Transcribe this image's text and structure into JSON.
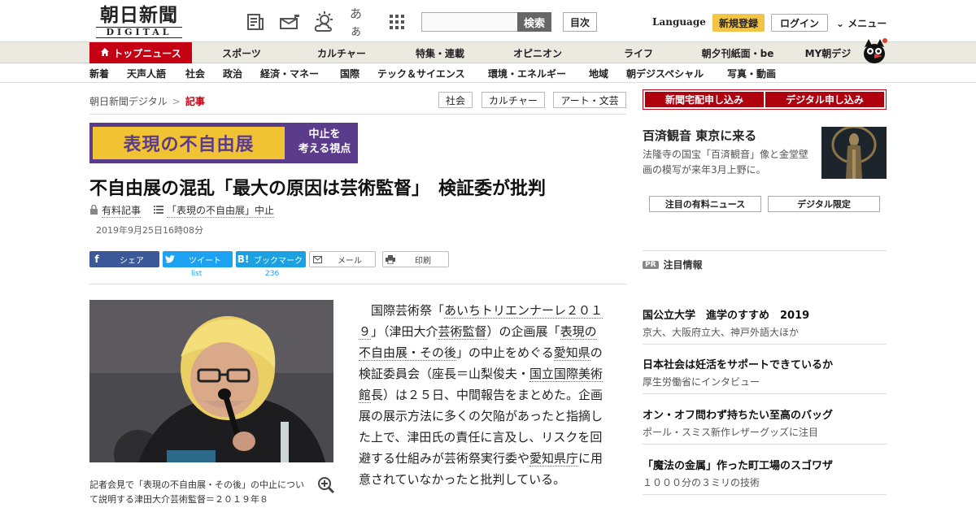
{
  "header": {
    "logo_main": "朝日新聞",
    "logo_sub": "DIGITAL",
    "search_button": "検索",
    "search_placeholder": "",
    "toc_button": "目次",
    "language_label": "Language",
    "register_button": "新規登録",
    "login_button": "ログイン",
    "menu_label": "メニュー",
    "font_size_icon_label": "あぁ"
  },
  "nav_primary": [
    {
      "label": "トップニュース",
      "active": true
    },
    {
      "label": "スポーツ"
    },
    {
      "label": "カルチャー"
    },
    {
      "label": "特集・連載"
    },
    {
      "label": "オピニオン"
    },
    {
      "label": "ライフ"
    },
    {
      "label": "朝夕刊紙面・be"
    },
    {
      "label": "MY朝デジ"
    }
  ],
  "nav_secondary": [
    {
      "label": "新着"
    },
    {
      "label": "天声人語"
    },
    {
      "label": "社会"
    },
    {
      "label": "政治"
    },
    {
      "label": "経済・マネー"
    },
    {
      "label": "国際"
    },
    {
      "label": "テック＆サイエンス"
    },
    {
      "label": "環境・エネルギー"
    },
    {
      "label": "地域"
    },
    {
      "label": "朝デジスペシャル"
    },
    {
      "label": "写真・動画"
    }
  ],
  "breadcrumb": {
    "home": "朝日新聞デジタル",
    "separator": ">",
    "current": "記事"
  },
  "tags": [
    "社会",
    "カルチャー",
    "アート・文芸"
  ],
  "banner": {
    "main": "表現の不自由展",
    "sub_line1": "中止を",
    "sub_line2": "考える視点"
  },
  "article": {
    "headline": "不自由展の混乱「最大の原因は芸術監督」　検証委が批判",
    "paid_label": "有料記事",
    "series_label": "「表現の不自由展」中止",
    "date": "2019年9月25日16時08分",
    "caption": "記者会見で「表現の不自由展・その後」の中止について説明する津田大介芸術監督＝２０１９年８",
    "body_parts": [
      "　国際芸術祭「",
      "あいちトリエンナーレ２０１９",
      "」（津田大介",
      "芸術監督",
      "）の企画展「",
      "表現の不自由展・その後",
      "」の中止をめぐる",
      "愛知県",
      "の検証委員会（座長＝山梨俊夫・",
      "国立国際美術館",
      "長）は２５日、中間報告をまとめた。企画展の展示方法に多くの欠陥があったと指摘した上で、津田氏の責任に言及し、リスクを回避する仕組みが芸術祭実行委や",
      "愛知県庁",
      "に用意されていなかったと批判している。"
    ]
  },
  "share": {
    "facebook": "シェア",
    "twitter": "ツイート",
    "twitter_count": "list",
    "hatena": "ブックマーク",
    "hatena_count": "236",
    "mail": "メール",
    "print": "印刷"
  },
  "sidebar": {
    "subscribe_delivery": "新聞宅配申し込み",
    "subscribe_digital": "デジタル申し込み",
    "promo_title": "百済観音 東京に来る",
    "promo_text": "法隆寺の国宝「百済観音」像と金堂壁画の模写が来年3月上野に。",
    "btn_paid_news": "注目の有料ニュース",
    "btn_digital_only": "デジタル限定",
    "pr_badge": "PR",
    "pr_heading": "注目情報",
    "pr_items": [
      {
        "title": "国公立大学　進学のすすめ　2019",
        "sub": "京大、大阪府立大、神戸外語大ほか"
      },
      {
        "title": "日本社会は妊活をサポートできているか",
        "sub": "厚生労働省にインタビュー"
      },
      {
        "title": "オン・オフ問わず持ちたい至高のバッグ",
        "sub": "ポール・スミス新作レザーグッズに注目"
      },
      {
        "title": "「魔法の金属」作った町工場のスゴワザ",
        "sub": "１０００分の３ミリの技術"
      }
    ]
  }
}
